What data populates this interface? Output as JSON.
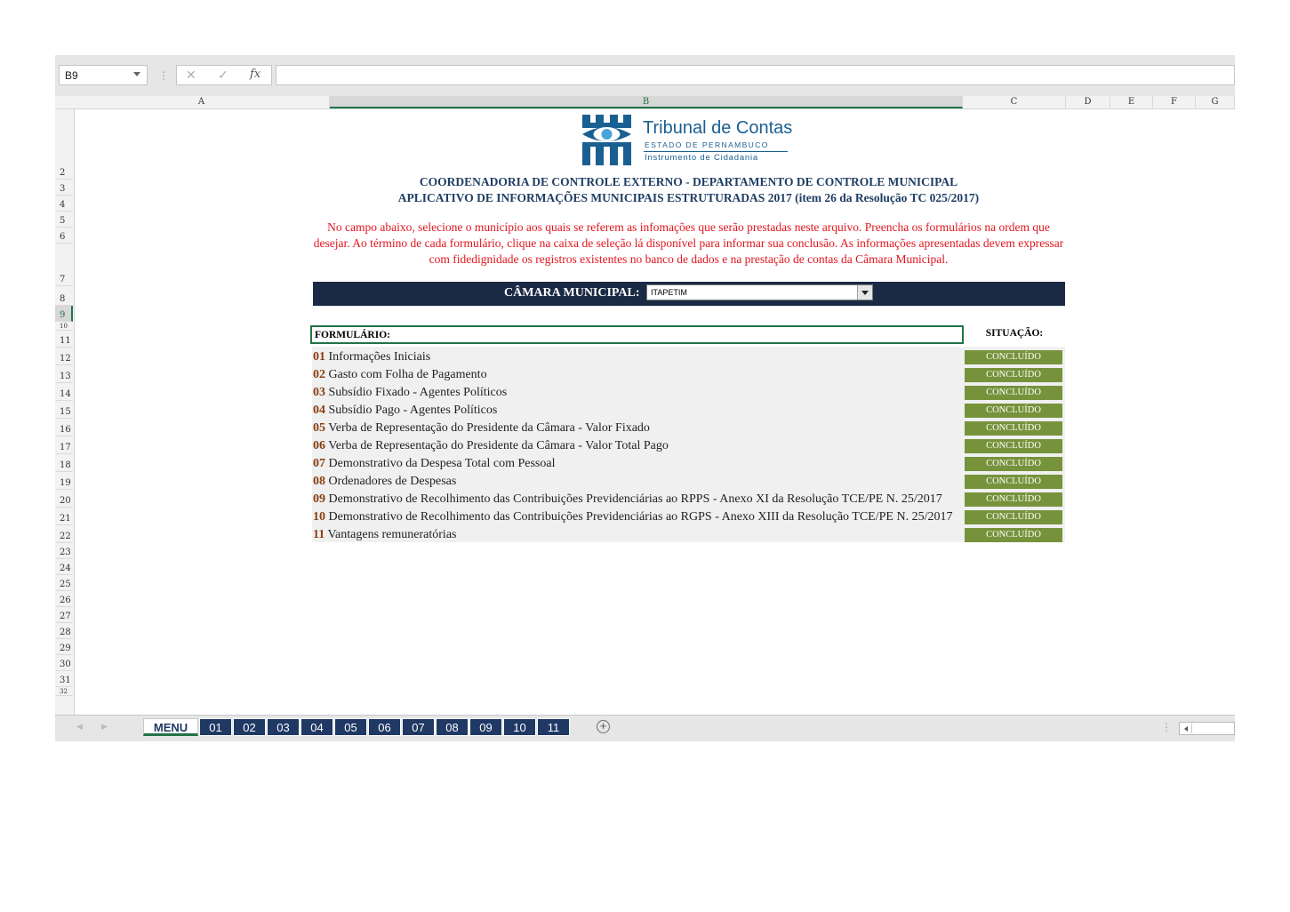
{
  "formula_bar": {
    "name_box": "B9",
    "cancel_icon": "close-icon",
    "enter_icon": "check-icon",
    "fx_label": "fx",
    "formula_value": ""
  },
  "columns": [
    "A",
    "B",
    "C",
    "D",
    "E",
    "F",
    "G"
  ],
  "selected_column": "B",
  "rows": [
    "2",
    "3",
    "4",
    "5",
    "6",
    "7",
    "8",
    "9",
    "10",
    "11",
    "12",
    "13",
    "14",
    "15",
    "16",
    "17",
    "18",
    "19",
    "20",
    "21",
    "22",
    "23",
    "24",
    "25",
    "26",
    "27",
    "28",
    "29",
    "30",
    "31",
    "32"
  ],
  "selected_row": "9",
  "logo": {
    "name": "Tribunal de Contas",
    "state": "ESTADO DE PERNAMBUCO",
    "tagline": "Instrumento de Cidadania"
  },
  "header": {
    "title1": "COORDENADORIA DE CONTROLE EXTERNO - DEPARTAMENTO DE CONTROLE MUNICIPAL",
    "title2": "APLICATIVO DE INFORMAÇÕES MUNICIPAIS ESTRUTURADAS 2017 (item 26 da Resolução TC 025/2017)"
  },
  "instructions": "No campo abaixo, selecione o município aos quais se referem as infomações que serão prestadas neste arquivo. Preencha os formulários na ordem que desejar. Ao término de cada formulário, clique na caixa de seleção lá disponível para informar sua conclusão. As informações apresentadas devem expressar com fidedignidade os registros existentes no banco de dados e na prestação de contas da Câmara Municipal.",
  "camara": {
    "label": "CÂMARA MUNICIPAL:",
    "selected": "ITAPETIM"
  },
  "forms_header": "FORMULÁRIO:",
  "status_header": "SITUAÇÃO:",
  "forms": [
    {
      "num": "01",
      "title": "Informações Iniciais",
      "status": "CONCLUÍDO"
    },
    {
      "num": "02",
      "title": "Gasto com Folha de Pagamento",
      "status": "CONCLUÍDO"
    },
    {
      "num": "03",
      "title": "Subsídio Fixado - Agentes Políticos",
      "status": "CONCLUÍDO"
    },
    {
      "num": "04",
      "title": "Subsídio Pago - Agentes Políticos",
      "status": "CONCLUÍDO"
    },
    {
      "num": "05",
      "title": "Verba de Representação do Presidente da Câmara - Valor Fixado",
      "status": "CONCLUÍDO"
    },
    {
      "num": "06",
      "title": "Verba de Representação do Presidente da Câmara - Valor Total Pago",
      "status": "CONCLUÍDO"
    },
    {
      "num": "07",
      "title": "Demonstrativo da Despesa Total com Pessoal",
      "status": "CONCLUÍDO"
    },
    {
      "num": "08",
      "title": "Ordenadores de Despesas",
      "status": "CONCLUÍDO"
    },
    {
      "num": "09",
      "title": "Demonstrativo de Recolhimento das Contribuições Previdenciárias ao RPPS - Anexo XI da Resolução TCE/PE N. 25/2017",
      "status": "CONCLUÍDO"
    },
    {
      "num": "10",
      "title": "Demonstrativo de Recolhimento das Contribuições Previdenciárias ao RGPS - Anexo XIII da Resolução TCE/PE N. 25/2017",
      "status": "CONCLUÍDO"
    },
    {
      "num": "11",
      "title": "Vantagens remuneratórias",
      "status": "CONCLUÍDO"
    }
  ],
  "tabs": [
    "MENU",
    "01",
    "02",
    "03",
    "04",
    "05",
    "06",
    "07",
    "08",
    "09",
    "10",
    "11"
  ],
  "active_tab": "MENU",
  "colors": {
    "navy": "#1b2a44",
    "badge_green": "#76933c",
    "notice_red": "#e0161e",
    "number_brown": "#8a3e12",
    "excel_green": "#217346"
  }
}
